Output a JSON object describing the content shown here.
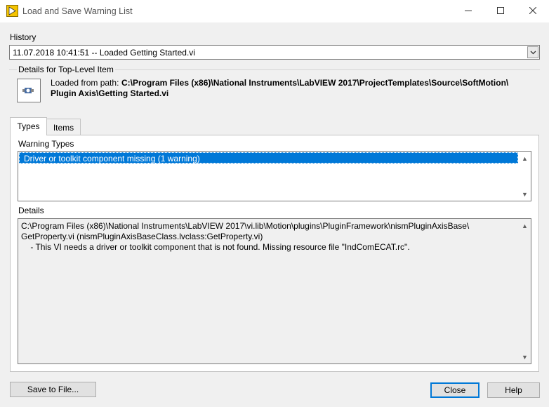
{
  "window": {
    "title": "Load and Save Warning List"
  },
  "history": {
    "label": "History",
    "value": "11.07.2018 10:41:51 -- Loaded Getting Started.vi"
  },
  "details_top": {
    "label": "Details for Top-Level Item",
    "loaded_prefix": "Loaded from path:",
    "path_line1": "C:\\Program Files (x86)\\National Instruments\\LabVIEW 2017\\ProjectTemplates\\Source\\SoftMotion\\",
    "path_line2": "Plugin Axis\\Getting Started.vi"
  },
  "tabs": [
    {
      "label": "Types"
    },
    {
      "label": "Items"
    }
  ],
  "warning_types": {
    "label": "Warning Types",
    "items": [
      "Driver or toolkit component missing (1 warning)"
    ]
  },
  "details": {
    "label": "Details",
    "text": "C:\\Program Files (x86)\\National Instruments\\LabVIEW 2017\\vi.lib\\Motion\\plugins\\PluginFramework\\nismPluginAxisBase\\\nGetProperty.vi (nismPluginAxisBaseClass.lvclass:GetProperty.vi)\n    - This VI needs a driver or toolkit component that is not found. Missing resource file \"IndComECAT.rc\"."
  },
  "buttons": {
    "save": "Save to File...",
    "close": "Close",
    "help": "Help"
  },
  "colors": {
    "selection": "#0078d7",
    "app_icon": "#f5c400"
  },
  "icons": [
    "labview-app-icon",
    "minimize-icon",
    "maximize-icon",
    "close-icon",
    "vi-icon",
    "chevron-down-icon",
    "scroll-up-icon",
    "scroll-down-icon"
  ]
}
